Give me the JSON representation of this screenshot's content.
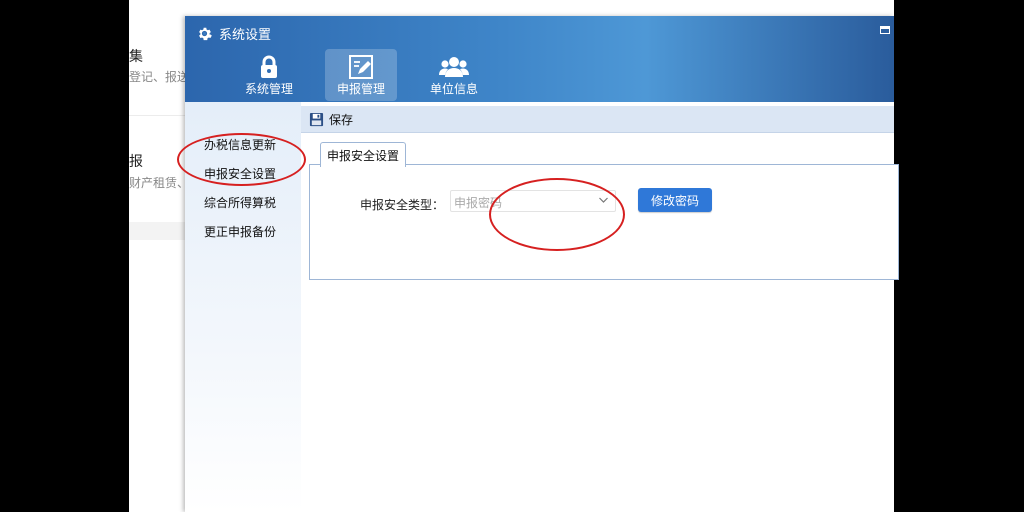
{
  "background_app": {
    "item1_title": "集",
    "item1_sub": "登记、报送",
    "item2_title": "报",
    "item2_sub": "财产租赁、"
  },
  "dialog": {
    "title": "系统设置",
    "nav_tabs": [
      {
        "label": "系统管理",
        "icon": "lock-icon"
      },
      {
        "label": "申报管理",
        "icon": "edit-report-icon"
      },
      {
        "label": "单位信息",
        "icon": "users-icon"
      }
    ],
    "active_nav": "申报管理",
    "sidebar": {
      "items": [
        {
          "label": "办税信息更新"
        },
        {
          "label": "申报安全设置"
        },
        {
          "label": "综合所得算税"
        },
        {
          "label": "更正申报备份"
        }
      ]
    },
    "toolbar": {
      "save_label": "保存"
    },
    "tab": {
      "label": "申报安全设置"
    },
    "form": {
      "type_label": "申报安全类型：",
      "type_value": "申报密码",
      "change_button": "修改密码"
    }
  },
  "colors": {
    "header_blue": "#3f86c9",
    "accent_button": "#2f78d8",
    "annotation_red": "#d62020",
    "toolbar_bg": "#dbe6f4"
  }
}
